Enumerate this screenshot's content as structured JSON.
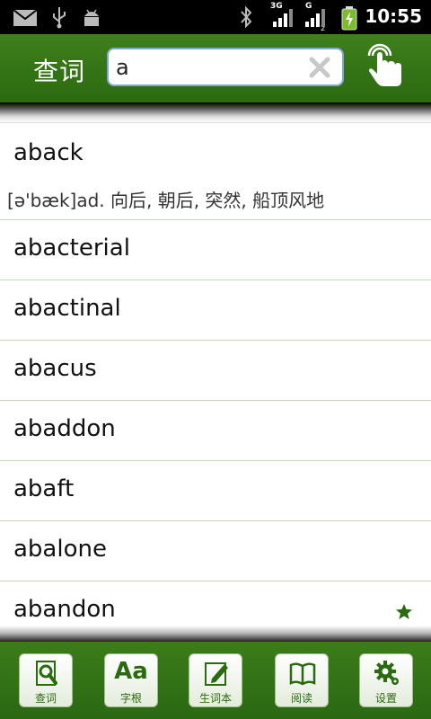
{
  "status_bar": {
    "time": "10:55",
    "net1": "3G",
    "net2": "G",
    "net2_sub": "2"
  },
  "header": {
    "title": "查词"
  },
  "search": {
    "value": "a"
  },
  "words": [
    {
      "word": "aback",
      "definition": "[ə'bæk]ad. 向后, 朝后, 突然, 船顶风地",
      "starred": false
    },
    {
      "word": "abacterial",
      "starred": false
    },
    {
      "word": "abactinal",
      "starred": false
    },
    {
      "word": "abacus",
      "starred": false
    },
    {
      "word": "abaddon",
      "starred": false
    },
    {
      "word": "abaft",
      "starred": false
    },
    {
      "word": "abalone",
      "starred": false
    },
    {
      "word": "abandon",
      "starred": true
    }
  ],
  "tabs": [
    {
      "label": "查词",
      "icon": "search-word-icon"
    },
    {
      "label": "字根",
      "icon": "aa-icon",
      "glyph": "Aa"
    },
    {
      "label": "生词本",
      "icon": "notebook-edit-icon"
    },
    {
      "label": "阅读",
      "icon": "book-icon"
    },
    {
      "label": "设置",
      "icon": "gear-icon"
    }
  ],
  "colors": {
    "brand_green": "#2b6a10",
    "divider": "#c9d7b8",
    "search_border": "#7fa6d8"
  }
}
